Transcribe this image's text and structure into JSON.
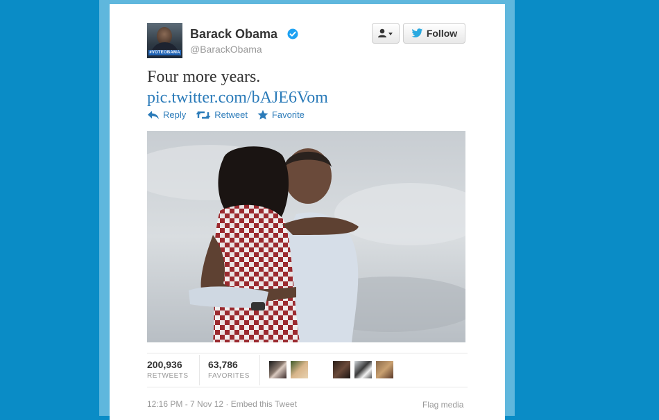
{
  "user": {
    "name": "Barack Obama",
    "handle": "@BarackObama",
    "avatar_tag": "#VOTEOBAMA"
  },
  "buttons": {
    "follow_label": "Follow",
    "user_menu_icon": "person-dropdown-icon"
  },
  "tweet": {
    "text": "Four more years.",
    "link": "pic.twitter.com/bAJE6Vom"
  },
  "actions": [
    {
      "label": "Reply",
      "icon": "reply-icon"
    },
    {
      "label": "Retweet",
      "icon": "retweet-icon"
    },
    {
      "label": "Favorite",
      "icon": "star-icon"
    }
  ],
  "stats": {
    "retweets_count": "200,936",
    "retweets_label": "RETWEETS",
    "favorites_count": "63,786",
    "favorites_label": "FAVORITES"
  },
  "footer": {
    "timestamp": "12:16 PM - 7 Nov 12",
    "separator": " · ",
    "embed": "Embed this Tweet",
    "flag": "Flag media"
  },
  "colors": {
    "background": "#0a8cc6",
    "link": "#2b7bb9",
    "verified": "#1da1f2"
  }
}
